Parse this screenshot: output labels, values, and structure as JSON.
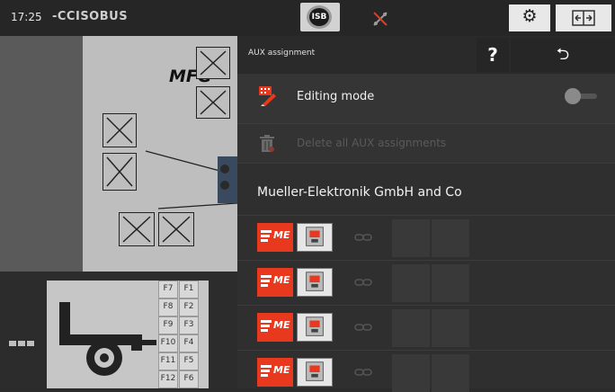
{
  "status_bar": {
    "time": "17:25",
    "brand": "-CCISOBUS",
    "isb_label": "ISB"
  },
  "left_panel": {
    "mask_logo": "MFG",
    "function_keys": [
      "F7",
      "F1",
      "F8",
      "F2",
      "F9",
      "F3",
      "F10",
      "F4",
      "F11",
      "F5",
      "F12",
      "F6"
    ]
  },
  "aux_panel": {
    "title": "AUX assignment",
    "help_label": "?",
    "back_label": "⮌",
    "editing_mode_label": "Editing mode",
    "editing_mode_enabled": false,
    "delete_all_label": "Delete all AUX assignments",
    "company_label": "Mueller-Elektronik GmbH and Co",
    "assignment_rows": 4
  },
  "colors": {
    "accent_red": "#e8391f",
    "panel_bg": "#2f2f2f",
    "topbar_bg": "#262626"
  },
  "icons": [
    "isb-icon",
    "disconnect-icon",
    "gear-icon",
    "switch-screen-icon",
    "edit-icon",
    "trash-icon",
    "link-icon",
    "joystick-icon",
    "me-logo-icon"
  ]
}
